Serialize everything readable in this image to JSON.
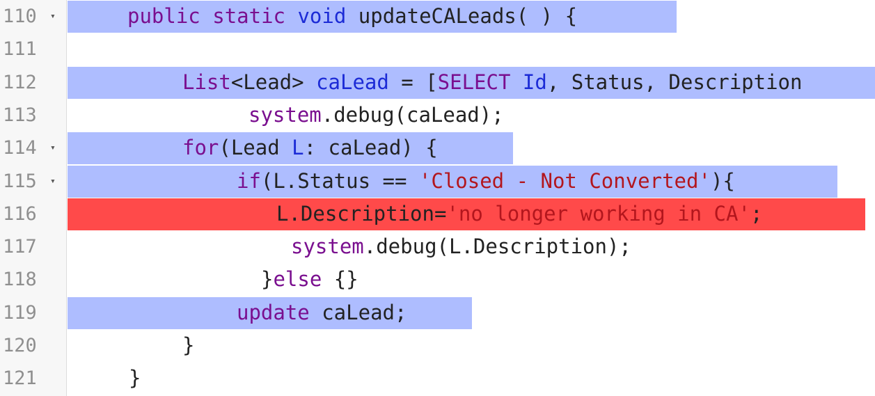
{
  "editor": {
    "lines": [
      {
        "num": "110",
        "fold": "▾",
        "parts": [
          {
            "t": "public",
            "c": "kw"
          },
          {
            "t": " "
          },
          {
            "t": "static",
            "c": "kw"
          },
          {
            "t": " "
          },
          {
            "t": "void",
            "c": "tp"
          },
          {
            "t": " updateCALeads( ) {"
          }
        ]
      },
      {
        "num": "111",
        "fold": "",
        "parts": []
      },
      {
        "num": "112",
        "fold": "",
        "parts": [
          {
            "t": "List",
            "c": "kw"
          },
          {
            "t": "<Lead> "
          },
          {
            "t": "caLead",
            "c": "tp"
          },
          {
            "t": " = ["
          },
          {
            "t": "SELECT",
            "c": "kw"
          },
          {
            "t": " "
          },
          {
            "t": "Id",
            "c": "tp"
          },
          {
            "t": ", Status, Description"
          }
        ]
      },
      {
        "num": "113",
        "fold": "",
        "parts": [
          {
            "t": "system",
            "c": "kw"
          },
          {
            "t": ".debug(caLead);"
          }
        ]
      },
      {
        "num": "114",
        "fold": "▾",
        "parts": [
          {
            "t": "for",
            "c": "kw"
          },
          {
            "t": "(Lead "
          },
          {
            "t": "L",
            "c": "tp"
          },
          {
            "t": ": caLead) {"
          }
        ]
      },
      {
        "num": "115",
        "fold": "▾",
        "parts": [
          {
            "t": "if",
            "c": "kw"
          },
          {
            "t": "(L.Status == "
          },
          {
            "t": "'Closed - Not Converted'",
            "c": "str"
          },
          {
            "t": "){"
          }
        ]
      },
      {
        "num": "116",
        "fold": "",
        "parts": [
          {
            "t": "L.Description="
          },
          {
            "t": "'no longer working in CA'",
            "c": "str"
          },
          {
            "t": ";"
          }
        ]
      },
      {
        "num": "117",
        "fold": "",
        "parts": [
          {
            "t": "system",
            "c": "kw"
          },
          {
            "t": ".debug(L.Description);"
          }
        ]
      },
      {
        "num": "118",
        "fold": "",
        "parts": [
          {
            "t": "}"
          },
          {
            "t": "else",
            "c": "kw"
          },
          {
            "t": " {}"
          }
        ]
      },
      {
        "num": "119",
        "fold": "",
        "parts": [
          {
            "t": "update",
            "c": "kw"
          },
          {
            "t": " caLead;"
          }
        ]
      },
      {
        "num": "120",
        "fold": "",
        "parts": [
          {
            "t": "}"
          }
        ]
      },
      {
        "num": "121",
        "fold": "",
        "parts": [
          {
            "t": "}"
          }
        ]
      }
    ],
    "colors": {
      "selection": "#aebdff",
      "error": "#ff4a4a",
      "keyword": "#7a0f8f",
      "type": "#1c2bd6",
      "string": "#b3161d",
      "line_number": "#8f8f8f"
    }
  }
}
